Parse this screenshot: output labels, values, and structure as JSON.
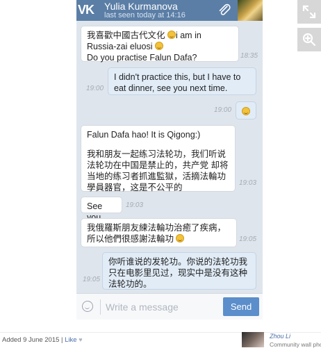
{
  "header": {
    "logo_text": "VK",
    "contact_name": "Yulia Kurmanova",
    "status": "last seen today at 14:16"
  },
  "messages": [
    {
      "direction": "in",
      "text_part1": "我喜歡中國古代文化 ",
      "text_part2": "i am in Russia-zai eluosi ",
      "text_part3": "Do you practise Falun Dafa?",
      "time": "18:35"
    },
    {
      "direction": "out",
      "text": "I didn't practice this, but I have to eat dinner, see you next time.",
      "time": "19:00"
    },
    {
      "direction": "out",
      "emoji_only": true,
      "time": "19:00"
    },
    {
      "direction": "in",
      "text_part1": "Falun Dafa hao! It is Qigong:)",
      "text_part2": "我和朋友一起练习法轮功，我们听说法轮功在中国是禁止的，共产党 却将当地的练习者抓進監獄，活摘法輪功學員器官，这是不公平的",
      "time": "19:03"
    },
    {
      "direction": "in",
      "text": "See you",
      "time": "19:03"
    },
    {
      "direction": "in",
      "text": "我俄羅斯朋友練法輪功治癒了疾病，所以他們很感謝法輪功 ",
      "time": "19:05"
    },
    {
      "direction": "out",
      "text": "你听谁说的发轮功。你说的法轮功我只在电影里见过，现实中是没有这种法轮功的。",
      "time": "19:05"
    }
  ],
  "composer": {
    "placeholder": "Write a message",
    "send_label": "Send"
  },
  "footer": {
    "added": "Added 9 June 2015",
    "separator": "|",
    "like": "Like",
    "commenter_name": "Zhou Li",
    "commenter_sub": "Community wall pho"
  },
  "colors": {
    "header": "#5b7ea6",
    "send_button": "#5b8ecb",
    "chat_bg": "#dfe5ec"
  }
}
